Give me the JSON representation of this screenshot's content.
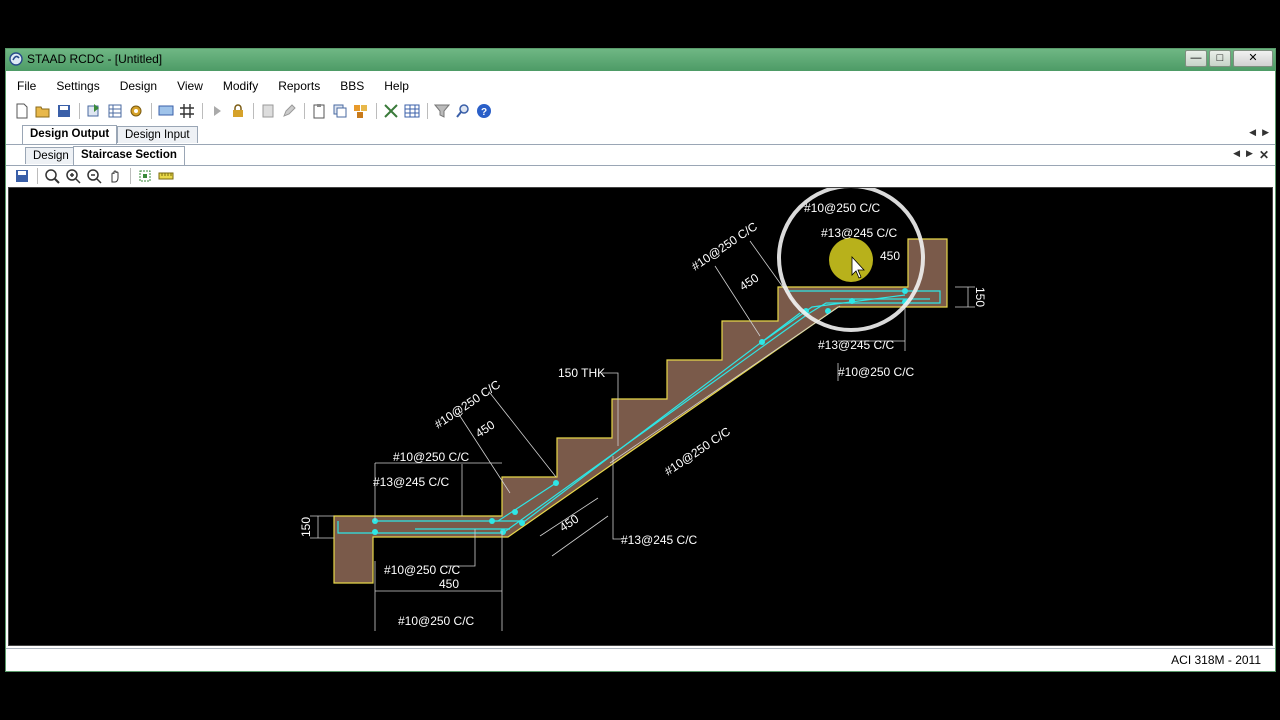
{
  "window": {
    "title": "STAAD RCDC - [Untitled]"
  },
  "menu": [
    "File",
    "Settings",
    "Design",
    "View",
    "Modify",
    "Reports",
    "BBS",
    "Help"
  ],
  "output_tabs": [
    {
      "label": "Design Output",
      "active": true
    },
    {
      "label": "Design Input",
      "active": false
    }
  ],
  "section_tabs": [
    {
      "label": "Design",
      "active": false
    },
    {
      "label": "Staircase Section",
      "active": true
    }
  ],
  "drawing": {
    "colors": {
      "concrete": "#7a5a4a",
      "outline": "#e8d84a",
      "rebar": "#2ee6e6",
      "text": "#ffffff",
      "dim": "#cfcfcf"
    },
    "labels": {
      "top_bar_upper": "#10@250 C/C",
      "top_bar_lower": "#13@245 C/C",
      "top_len": "450",
      "top_thk": "150",
      "top_flight_bar": "#10@250 C/C",
      "top_flight_len": "450",
      "top_under_a": "#13@245 C/C",
      "top_under_b": "#10@250 C/C",
      "waist_thk": "150 THK",
      "main_bar": "#10@250 C/C",
      "main_bottom_bar": "#13@245 C/C",
      "bot_flight_bar": "#10@250 C/C",
      "bot_flight_len": "450",
      "bot_landing_bar_upper": "#10@250 C/C",
      "bot_landing_bar_lower": "#13@245 C/C",
      "bot_thk": "150",
      "bot_under_bar": "#10@250 C/C",
      "bot_under_len": "450",
      "bot_diag_len": "450",
      "bot_bottom_dim": "#10@250 C/C"
    }
  },
  "status": {
    "code": "ACI 318M - 2011"
  }
}
